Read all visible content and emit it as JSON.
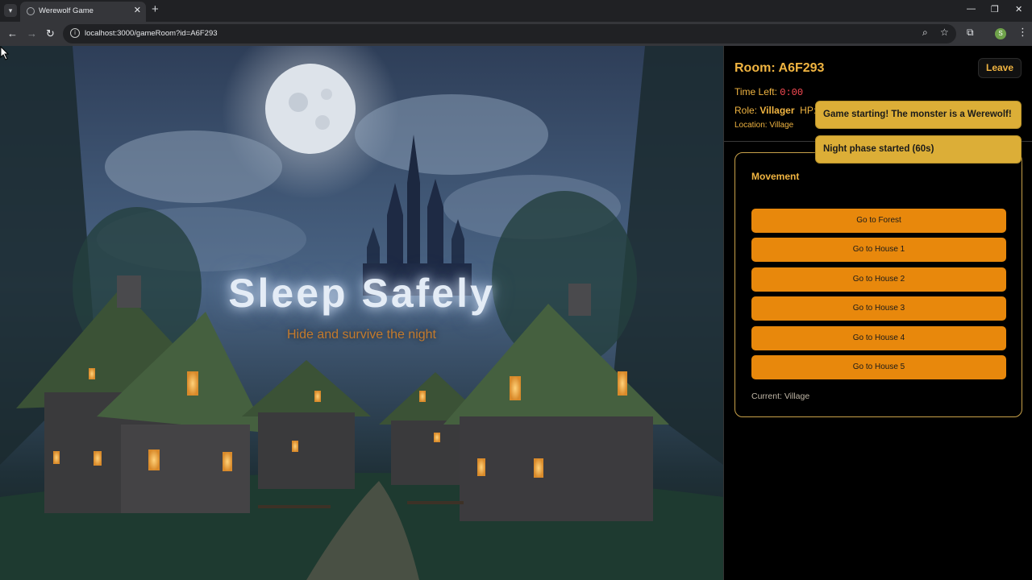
{
  "browser": {
    "tab_title": "Werewolf Game",
    "url": "localhost:3000/gameRoom?id=A6F293",
    "profile_initial": "S"
  },
  "scene": {
    "title": "Sleep Safely",
    "subtitle": "Hide and survive the night"
  },
  "room": {
    "title": "Room: A6F293",
    "leave_label": "Leave",
    "time_label": "Time Left:",
    "time_value": "0:00",
    "role_label": "Role:",
    "role_value": "Villager",
    "hp_label": "HP:",
    "location_text": "Location: Village"
  },
  "notifications": [
    "Game starting! The monster is a Werewolf!",
    "Night phase started (60s)"
  ],
  "movement": {
    "title": "Movement",
    "buttons": [
      "Go to Forest",
      "Go to House 1",
      "Go to House 2",
      "Go to House 3",
      "Go to House 4",
      "Go to House 5"
    ],
    "current_text": "Current: Village"
  },
  "colors": {
    "accent": "#f0b441",
    "button": "#e8880c",
    "toast": "#dcae37",
    "timer": "#ff4c55"
  },
  "icons": [
    "tab-list-icon",
    "globe-icon",
    "close-icon",
    "new-tab-icon",
    "minimize-icon",
    "restore-icon",
    "window-close-icon",
    "back-icon",
    "forward-icon",
    "reload-icon",
    "site-info-icon",
    "zoom-icon",
    "star-icon",
    "extensions-icon",
    "menu-icon",
    "cursor-icon"
  ]
}
